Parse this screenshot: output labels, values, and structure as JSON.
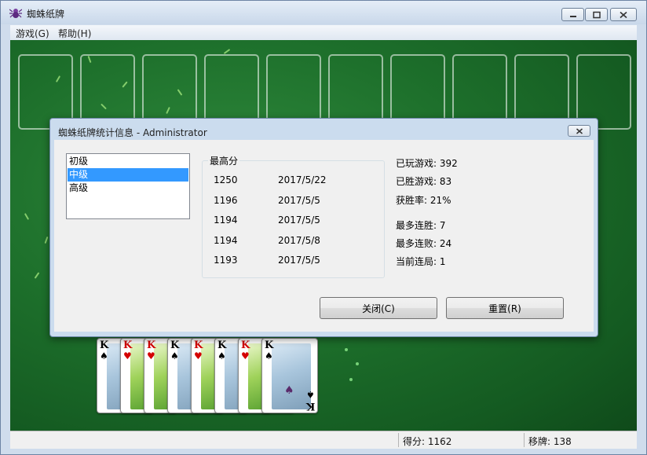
{
  "window": {
    "title": "蜘蛛纸牌"
  },
  "menu": {
    "items": [
      {
        "label": "游戏(G)"
      },
      {
        "label": "帮助(H)"
      }
    ]
  },
  "statusbar": {
    "score": "得分: 1162",
    "moves": "移牌:  138"
  },
  "cards": [
    {
      "rank": "K",
      "suit": "♠",
      "color": "#000000",
      "art": "spade"
    },
    {
      "rank": "K",
      "suit": "♥",
      "color": "#d40000",
      "art": "heart"
    },
    {
      "rank": "K",
      "suit": "♥",
      "color": "#d40000",
      "art": "heart"
    },
    {
      "rank": "K",
      "suit": "♠",
      "color": "#000000",
      "art": "spade"
    },
    {
      "rank": "K",
      "suit": "♥",
      "color": "#d40000",
      "art": "heart"
    },
    {
      "rank": "K",
      "suit": "♠",
      "color": "#000000",
      "art": "spade"
    },
    {
      "rank": "K",
      "suit": "♥",
      "color": "#d40000",
      "art": "heart"
    },
    {
      "rank": "K",
      "suit": "♠",
      "color": "#000000",
      "art": "spade"
    }
  ],
  "dialog": {
    "title": "蜘蛛纸牌统计信息 - Administrator",
    "levels": [
      {
        "label": "初级",
        "selected": false
      },
      {
        "label": "中级",
        "selected": true
      },
      {
        "label": "高级",
        "selected": false
      }
    ],
    "high_scores": {
      "label": "最高分",
      "rows": [
        {
          "score": "1250",
          "date": "2017/5/22"
        },
        {
          "score": "1196",
          "date": "2017/5/5"
        },
        {
          "score": "1194",
          "date": "2017/5/5"
        },
        {
          "score": "1194",
          "date": "2017/5/8"
        },
        {
          "score": "1193",
          "date": "2017/5/5"
        }
      ]
    },
    "stats": {
      "played": "已玩游戏: 392",
      "won": "已胜游戏: 83",
      "win_rate": "获胜率: 21%",
      "longest_win": "最多连胜: 7",
      "longest_loss": "最多连败: 24",
      "current_streak": "当前连局: 1"
    },
    "buttons": {
      "close": "关闭(C)",
      "reset": "重置(R)"
    }
  },
  "colors": {
    "felt": "#1d6f2b",
    "selection": "#3399ff",
    "dialog_frame": "#cbdcee"
  }
}
